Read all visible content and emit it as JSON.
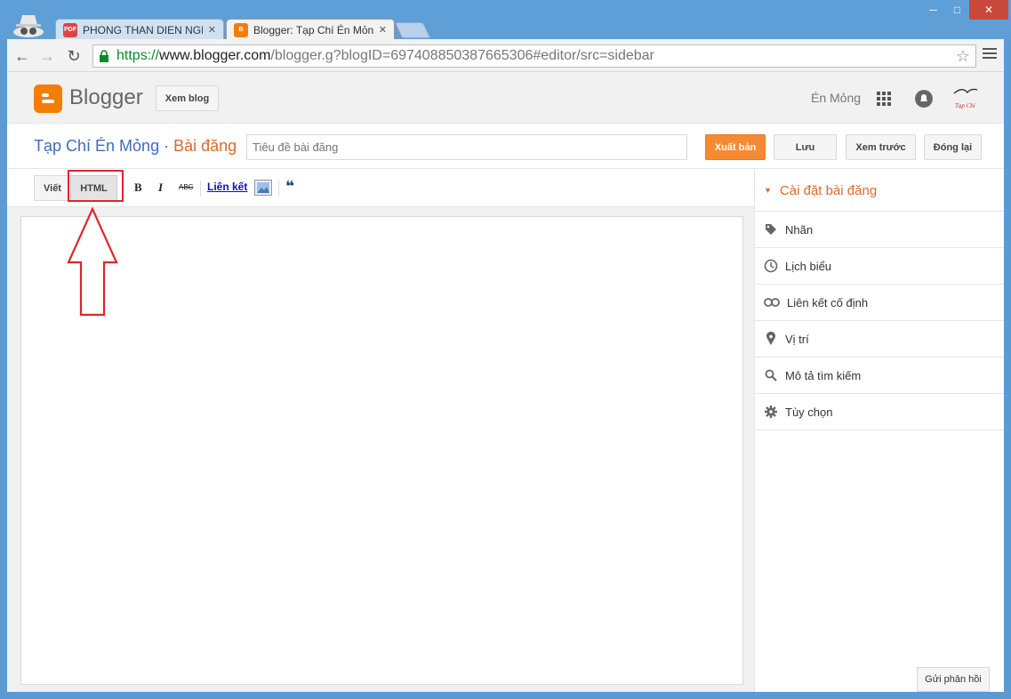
{
  "browser": {
    "tabs": [
      {
        "title": "PHONG THAN DIEN NGH",
        "favicon": "pdf-icon",
        "active": false
      },
      {
        "title": "Blogger: Tạp Chí Én Mỏng",
        "favicon": "blogger-icon",
        "active": true
      }
    ],
    "url": {
      "scheme": "https://",
      "host": "www.blogger.com",
      "path": "/blogger.g?blogID=697408850387665306#editor/src=sidebar"
    },
    "window_controls": {
      "minimize": "─",
      "maximize": "□",
      "close": "✕"
    }
  },
  "header": {
    "logo_text": "Blogger",
    "view_blog_label": "Xem blog",
    "user_name": "Én Mỏng",
    "avatar_text": "Tạp Chí"
  },
  "post_bar": {
    "blog_title": "Tạp Chí Én Mỏng",
    "separator": " · ",
    "section_title": "Bài đăng",
    "title_placeholder": "Tiêu đề bài đăng",
    "publish_label": "Xuất bản",
    "save_label": "Lưu",
    "preview_label": "Xem trước",
    "close_label": "Đóng lại"
  },
  "editor": {
    "compose_label": "Viết",
    "html_label": "HTML",
    "bold_label": "B",
    "italic_label": "I",
    "strike_label": "ABC",
    "link_label": "Liên kết",
    "quote_label": "❝"
  },
  "sidebar": {
    "header": "Cài đặt bài đăng",
    "items": [
      {
        "label": "Nhãn",
        "icon": "tag-icon"
      },
      {
        "label": "Lịch biểu",
        "icon": "clock-icon"
      },
      {
        "label": "Liên kết cố định",
        "icon": "link-icon"
      },
      {
        "label": "Vị trí",
        "icon": "location-icon"
      },
      {
        "label": "Mô tả tìm kiếm",
        "icon": "search-icon"
      },
      {
        "label": "Tùy chọn",
        "icon": "gear-icon"
      }
    ]
  },
  "feedback_label": "Gửi phản hồi",
  "colors": {
    "accent": "#f58a33",
    "blog_title": "#3e6dbd",
    "section": "#dd6a2a",
    "highlight": "#e0252b"
  }
}
